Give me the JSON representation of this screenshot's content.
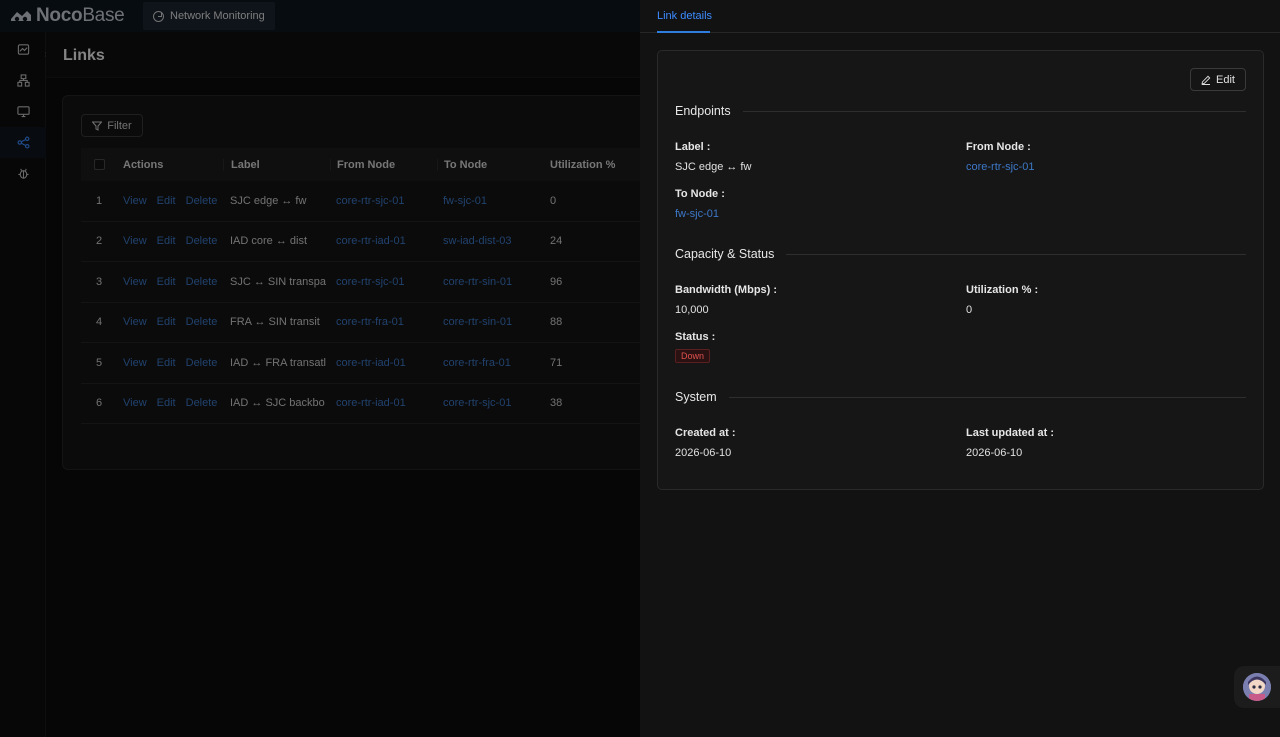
{
  "brand": {
    "name_bold": "Noco",
    "name_thin": "Base"
  },
  "top_menu": {
    "label": "Network Monitoring",
    "icon": "compass-icon"
  },
  "sidebar": {
    "items": [
      {
        "icon": "dashboard-icon"
      },
      {
        "icon": "cluster-icon"
      },
      {
        "icon": "desktop-icon"
      },
      {
        "icon": "share-icon"
      },
      {
        "icon": "bug-icon"
      }
    ],
    "active_index": 3
  },
  "page": {
    "title": "Links"
  },
  "toolbar": {
    "filter_label": "Filter"
  },
  "table": {
    "columns": [
      "Actions",
      "Label",
      "From Node",
      "To Node",
      "Utilization %"
    ],
    "row_actions": [
      "View",
      "Edit",
      "Delete"
    ],
    "rows": [
      {
        "index": "1",
        "label": "SJC edge ↔ fw",
        "from": "core-rtr-sjc-01",
        "to": "fw-sjc-01",
        "util": "0"
      },
      {
        "index": "2",
        "label": "IAD core ↔ dist",
        "from": "core-rtr-iad-01",
        "to": "sw-iad-dist-03",
        "util": "24"
      },
      {
        "index": "3",
        "label": "SJC ↔ SIN transpa",
        "from": "core-rtr-sjc-01",
        "to": "core-rtr-sin-01",
        "util": "96"
      },
      {
        "index": "4",
        "label": "FRA ↔ SIN transit",
        "from": "core-rtr-fra-01",
        "to": "core-rtr-sin-01",
        "util": "88"
      },
      {
        "index": "5",
        "label": "IAD ↔ FRA transatl",
        "from": "core-rtr-iad-01",
        "to": "core-rtr-fra-01",
        "util": "71"
      },
      {
        "index": "6",
        "label": "IAD ↔ SJC backbo",
        "from": "core-rtr-iad-01",
        "to": "core-rtr-sjc-01",
        "util": "38"
      }
    ]
  },
  "drawer": {
    "tab": "Link details",
    "edit_label": "Edit",
    "sections": {
      "endpoints": "Endpoints",
      "capacity": "Capacity & Status",
      "system": "System"
    },
    "fields": {
      "label": {
        "label": "Label :",
        "value": "SJC edge ↔ fw"
      },
      "from_node": {
        "label": "From Node :",
        "value": "core-rtr-sjc-01"
      },
      "to_node": {
        "label": "To Node :",
        "value": "fw-sjc-01"
      },
      "bandwidth": {
        "label": "Bandwidth (Mbps) :",
        "value": "10,000"
      },
      "utilization": {
        "label": "Utilization % :",
        "value": "0"
      },
      "status": {
        "label": "Status :",
        "value": "Down"
      },
      "created_at": {
        "label": "Created at :",
        "value": "2026-06-10"
      },
      "updated_at": {
        "label": "Last updated at :",
        "value": "2026-06-10"
      }
    }
  },
  "colors": {
    "link": "#3d78c8",
    "accent": "#2f7dde",
    "status_down": "#e05050"
  }
}
